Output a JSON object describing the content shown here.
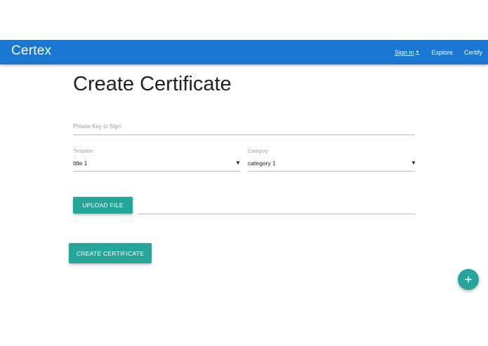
{
  "colors": {
    "primary": "#1976d2",
    "accent": "#26a69a",
    "text": "#212121",
    "muted": "#9e9e9e",
    "divider": "#bdbdbd"
  },
  "navbar": {
    "brand": "Certex",
    "sign_in": "Sign in",
    "sign_in_caret_icon": "caret-down-icon",
    "explore": "Explore",
    "certify": "Certify"
  },
  "page": {
    "title": "Create Certificate"
  },
  "form": {
    "private_key": {
      "placeholder": "Private Key to Sign",
      "value": ""
    },
    "template": {
      "label": "Template",
      "selected": "title 1",
      "arrow_icon": "dropdown-arrow-icon"
    },
    "category": {
      "label": "Category",
      "selected": "category 1",
      "arrow_icon": "dropdown-arrow-icon"
    },
    "upload": {
      "button_label": "UPLOAD FILE",
      "file_path": ""
    },
    "submit_label": "CREATE CERTIFICATE"
  },
  "fab": {
    "icon": "plus-icon"
  }
}
